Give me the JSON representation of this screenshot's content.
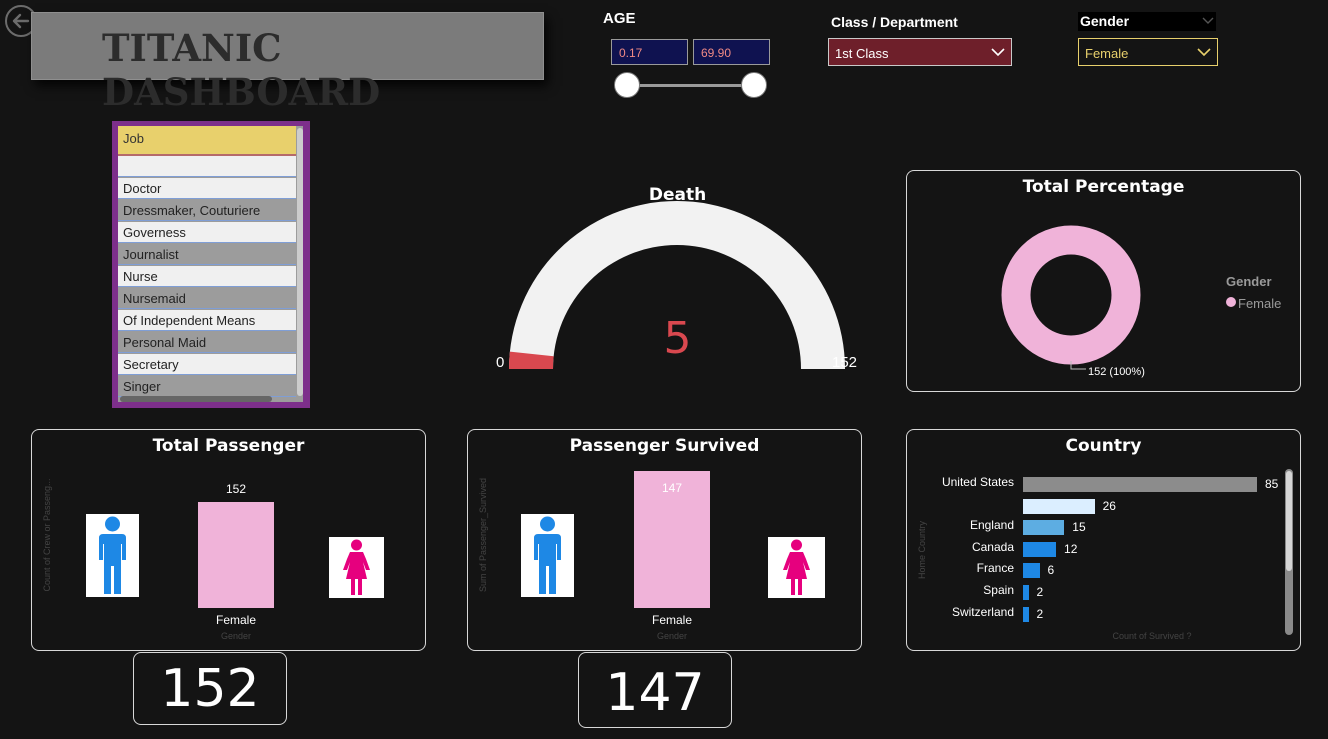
{
  "header": {
    "title": "TITANIC DASHBOARD"
  },
  "age_slicer": {
    "label": "AGE",
    "min_value": "0.17",
    "max_value": "69.90"
  },
  "class_slicer": {
    "label": "Class / Department",
    "selected": "1st Class"
  },
  "gender_slicer": {
    "label": "Gender",
    "selected": "Female"
  },
  "job_slicer": {
    "header": "Job",
    "items": [
      "",
      "Doctor",
      "Dressmaker, Couturiere",
      "Governess",
      "Journalist",
      "Nurse",
      "Nursemaid",
      "Of Independent Means",
      "Personal Maid",
      "Secretary",
      "Singer"
    ]
  },
  "death_gauge": {
    "title": "Death",
    "value": 5,
    "value_label": "5",
    "min_label": "0",
    "max_label": "152",
    "min": 0,
    "max": 152,
    "fill_color": "#d9484f",
    "track_color": "#f2f2f2"
  },
  "total_percentage": {
    "title": "Total Percentage",
    "legend_title": "Gender",
    "legend_item": "Female",
    "data_label": "152 (100%)",
    "color": "#f0b3d9"
  },
  "total_passenger": {
    "title": "Total Passenger",
    "y_axis_label": "Count of Crew or Passeng...",
    "x_axis_label": "Gender",
    "bar_label": "152",
    "category": "Female",
    "kpi": "152"
  },
  "passenger_survived": {
    "title": "Passenger Survived",
    "y_axis_label": "Sum of Passenger_Survived",
    "x_axis_label": "Gender",
    "bar_label": "147",
    "category": "Female",
    "kpi": "147"
  },
  "country": {
    "title": "Country",
    "y_axis_label": "Home Country",
    "x_axis_label": "Count of Survived ?"
  },
  "colors": {
    "background": "#141414",
    "pink": "#f0b3d9",
    "male_icon": "#1e88e5",
    "female_icon": "#e6007e",
    "class_dropdown": "#6e1f2a",
    "gender_dropdown_border": "#e8d06c"
  },
  "icons": {
    "back": "back-arrow-icon",
    "dropdown": "chevron-down-icon",
    "male": "male-person-icon",
    "female": "female-person-icon"
  },
  "chart_data": [
    {
      "type": "bar",
      "categories": [
        "Female"
      ],
      "values": [
        152
      ],
      "title": "Total Passenger",
      "xlabel": "Gender",
      "ylabel": "Count of Crew or Passeng..."
    },
    {
      "type": "bar",
      "categories": [
        "Female"
      ],
      "values": [
        147
      ],
      "title": "Passenger Survived",
      "xlabel": "Gender",
      "ylabel": "Sum of Passenger_Survived"
    },
    {
      "type": "pie",
      "categories": [
        "Female"
      ],
      "values": [
        152
      ],
      "title": "Total Percentage",
      "legend_title": "Gender"
    },
    {
      "type": "bar",
      "orientation": "horizontal",
      "title": "Country",
      "xlabel": "Count of Survived ?",
      "ylabel": "Home Country",
      "categories": [
        "United States",
        "",
        "England",
        "Canada",
        "France",
        "Spain",
        "Switzerland"
      ],
      "values": [
        85,
        26,
        15,
        12,
        6,
        2,
        2
      ],
      "value_labels": [
        "85",
        "26",
        "15",
        "12",
        "6",
        "2",
        "2"
      ],
      "colors": [
        "#8c8c8c",
        "#dbeeff",
        "#5dade2",
        "#1e88e5",
        "#1e88e5",
        "#1e88e5",
        "#1e88e5"
      ]
    }
  ]
}
